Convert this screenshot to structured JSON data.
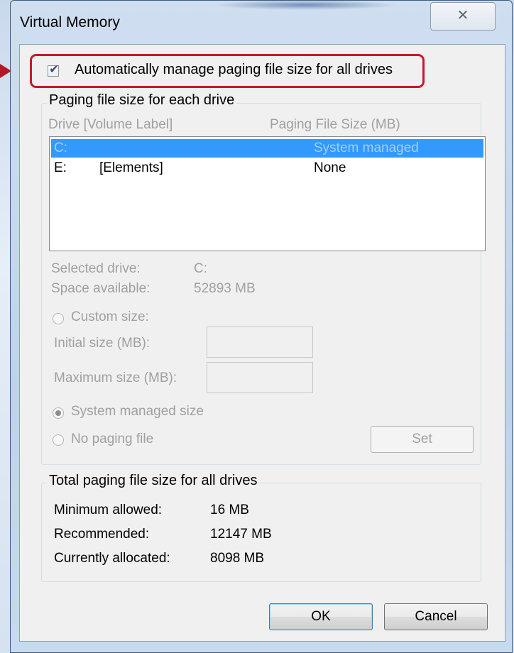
{
  "window": {
    "title": "Virtual Memory",
    "close_glyph": "✕"
  },
  "auto_manage": {
    "label": "Automatically manage paging file size for all drives",
    "checked": true,
    "check_glyph": "✔"
  },
  "paging_group": {
    "title": "Paging file size for each drive",
    "col_drive": "Drive  [Volume Label]",
    "col_size": "Paging File Size (MB)",
    "drives": [
      {
        "drive": "C:",
        "label": "",
        "size": "System managed",
        "selected": true
      },
      {
        "drive": "E:",
        "label": "[Elements]",
        "size": "None",
        "selected": false
      }
    ]
  },
  "selected_drive": {
    "label": "Selected drive:",
    "value": "C:"
  },
  "space_available": {
    "label": "Space available:",
    "value": "52893 MB"
  },
  "options": {
    "custom_size": "Custom size:",
    "initial_size_label": "Initial size (MB):",
    "initial_size_value": "",
    "maximum_size_label": "Maximum size (MB):",
    "maximum_size_value": "",
    "system_managed": "System managed size",
    "no_paging": "No paging file",
    "selected": "system_managed"
  },
  "buttons": {
    "set": "Set",
    "ok": "OK",
    "cancel": "Cancel"
  },
  "totals": {
    "title": "Total paging file size for all drives",
    "min_label": "Minimum allowed:",
    "min_value": "16 MB",
    "rec_label": "Recommended:",
    "rec_value": "12147 MB",
    "cur_label": "Currently allocated:",
    "cur_value": "8098 MB"
  },
  "colors": {
    "highlight_box": "#c21c2a",
    "selection": "#3399ff"
  }
}
